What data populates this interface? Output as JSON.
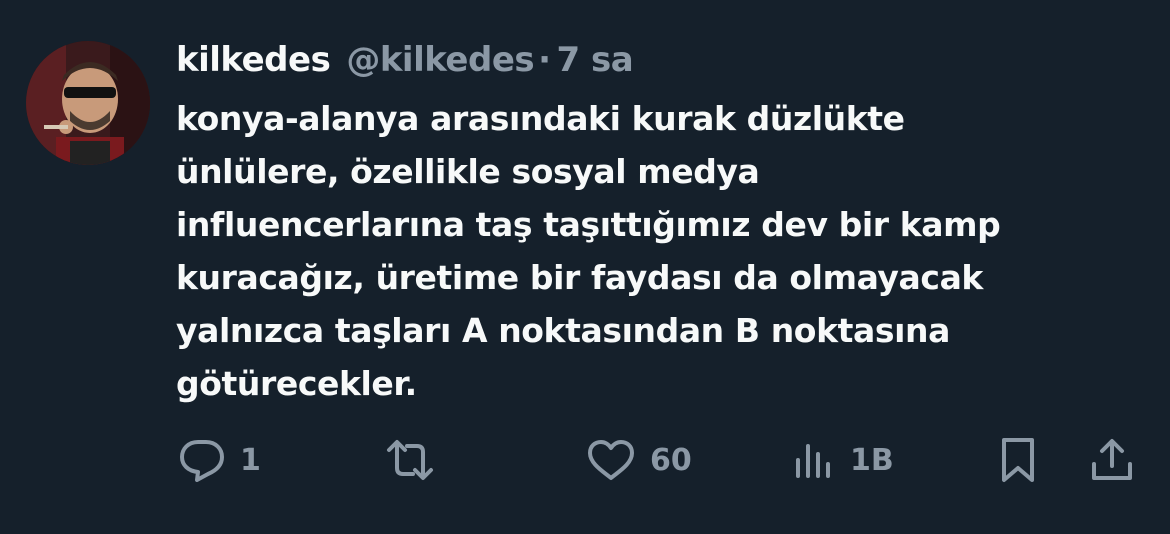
{
  "tweet": {
    "display_name": "kilkedes",
    "handle": "@kilkedes",
    "separator": "·",
    "time": "7 sa",
    "text_lines": [
      "konya-alanya arasındaki kurak düzlükte",
      "ünlülere, özellikle sosyal medya",
      "influencerlarına taş taşıttığımız dev bir kamp",
      "kuracağız, üretime bir faydası da olmayacak",
      "yalnızca taşları A noktasından B noktasına",
      "götürecekler."
    ]
  },
  "actions": {
    "reply_count": "1",
    "like_count": "60",
    "views_count": "1B"
  },
  "icons": {
    "reply": "reply-icon",
    "retweet": "retweet-icon",
    "like": "heart-icon",
    "views": "views-icon",
    "bookmark": "bookmark-icon",
    "share": "share-icon"
  },
  "colors": {
    "background": "#15202b",
    "primary_text": "#f7f9f9",
    "secondary_text": "#8b98a5"
  }
}
